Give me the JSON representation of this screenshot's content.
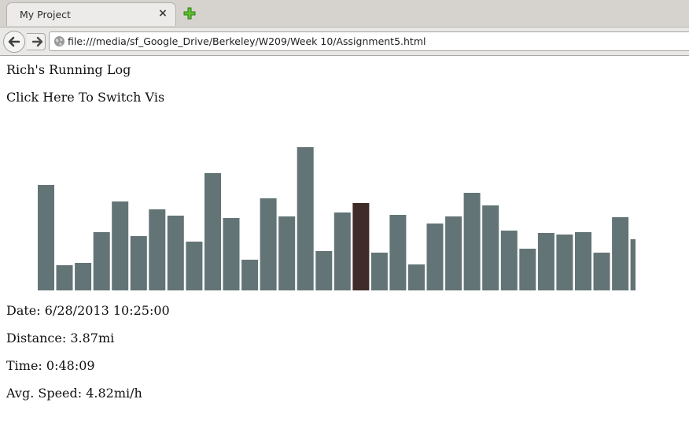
{
  "browser": {
    "tab_title": "My Project",
    "tab_close_glyph": "×",
    "url": "file:///media/sf_Google_Drive/Berkeley/W209/Week 10/Assignment5.html",
    "icons": [
      "close-icon",
      "new-tab-plus-icon",
      "back-arrow-icon",
      "forward-arrow-icon",
      "globe-icon"
    ]
  },
  "page": {
    "title": "Rich's Running Log",
    "switch_link": "Click Here To Switch Vis",
    "date_line": "Date: 6/28/2013 10:25:00",
    "distance_line": "Distance: 3.87mi",
    "time_line": "Time: 0:48:09",
    "speed_line": "Avg. Speed: 4.82mi/h"
  },
  "colors": {
    "bar": "#637476",
    "bar_selected": "#3f2b29"
  },
  "chart_data": {
    "type": "bar",
    "values": [
      134,
      32,
      35,
      74,
      113,
      69,
      103,
      95,
      62,
      149,
      92,
      39,
      117,
      94,
      182,
      50,
      99,
      111,
      48,
      96,
      33,
      85,
      94,
      124,
      108,
      76,
      53,
      73,
      71,
      74,
      48,
      93,
      65
    ],
    "selected_index": 17,
    "ylim": [
      0,
      182
    ],
    "grid": false,
    "title": "",
    "xlabel": "",
    "ylabel": ""
  }
}
